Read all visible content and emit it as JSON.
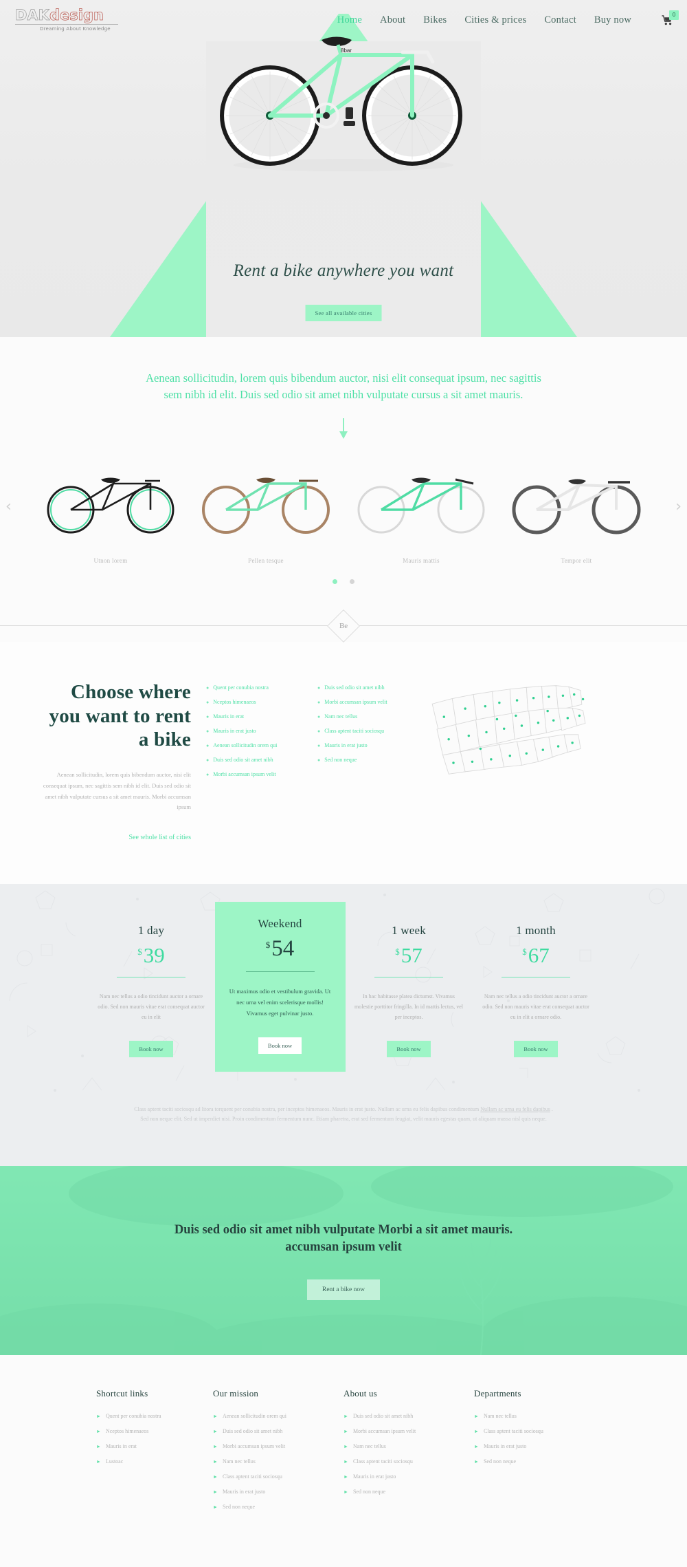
{
  "colors": {
    "mint": "#9df5c6",
    "mint_text": "#4ee0a6",
    "dark_teal": "#1f4a44",
    "grey_text": "#b3b3b3",
    "hero_bg": "#eaeaea",
    "pricing_bg": "#eceef0"
  },
  "header": {
    "logo_main_1": "DAK",
    "logo_main_2": "design",
    "logo_tagline": "Dreaming About Knowledge",
    "nav": [
      {
        "label": "Home",
        "active": true
      },
      {
        "label": "About",
        "active": false
      },
      {
        "label": "Bikes",
        "active": false
      },
      {
        "label": "Cities & prices",
        "active": false
      },
      {
        "label": "Contact",
        "active": false
      },
      {
        "label": "Buy now",
        "active": false
      }
    ],
    "cart_icon": "shopping-cart-icon",
    "cart_count": "0"
  },
  "hero": {
    "title": "Rent a bike anywhere you want",
    "button": "See all available cities"
  },
  "intro": {
    "lead": "Aenean sollicitudin, lorem quis bibendum auctor, nisi elit consequat ipsum, nec sagittis sem nibh id elit. Duis sed odio sit amet nibh vulputate cursus a sit amet mauris.",
    "arrow_icon": "arrow-down-icon"
  },
  "carousel": {
    "prev_icon": "chevron-left-icon",
    "next_icon": "chevron-right-icon",
    "items": [
      {
        "caption": "Utnon lorem"
      },
      {
        "caption": "Pellen tesque"
      },
      {
        "caption": "Mauris mattis"
      },
      {
        "caption": "Tempor elit"
      }
    ],
    "dots": [
      {
        "active": true
      },
      {
        "active": false
      }
    ]
  },
  "divider": {
    "label": "Be"
  },
  "cities": {
    "heading": "Choose where you want to rent a bike",
    "paragraph": "Aenean sollicitudin, lorem quis bibendum auctor, nisi elit consequat ipsum, nec sagittis sem nibh id elit. Duis sed odio sit amet nibh vulputate cursus a sit amet mauris. Morbi accumsan ipsum",
    "link": "See whole list of cities",
    "col1": [
      "Quent per conubia nostra",
      "Nceptos himenaeos",
      "Mauris in erat",
      "Mauris in erat justo",
      "Aenean sollicitudin orem qui",
      "Duis sed odio sit amet nibh",
      "Morbi accumsan ipsum velit"
    ],
    "col2": [
      "Duis sed odio sit amet nibh",
      "Morbi accumsan ipsum velit",
      "Nam nec tellus",
      "Class aptent taciti sociosqu",
      "Mauris in erat justo",
      "Sed non neque"
    ],
    "map_icon": "usa-map"
  },
  "pricing": {
    "plans": [
      {
        "title": "1 day",
        "currency": "$",
        "amount": "39",
        "desc": "Nam nec tellus a odio tincidunt auctor a ornare odio. Sed non mauris vitae erat consequat auctor eu in elit",
        "button": "Book now",
        "featured": false
      },
      {
        "title": "Weekend",
        "currency": "$",
        "amount": "54",
        "desc": "Ut maximus odio et vestibulum gravida. Ut nec urna vel enim scelerisque mollis! Vivamus eget pulvinar justo.",
        "button": "Book now",
        "featured": true
      },
      {
        "title": "1 week",
        "currency": "$",
        "amount": "57",
        "desc": "In hac habitasse platea dictumst. Vivamus molestie porttitor fringilla. In id mattis lectus, vel per inceptos.",
        "button": "Book now",
        "featured": false
      },
      {
        "title": "1 month",
        "currency": "$",
        "amount": "67",
        "desc": "Nam nec tellus a odio tincidunt auctor a ornare odio. Sed non mauris vitae erat consequat auctor eu in elit a ornare odio.",
        "button": "Book now",
        "featured": false
      }
    ],
    "note_a": "Class aptent taciti sociosqu ad litora torquent per conubia nostra, per inceptos himenaeos. Mauris in erat justo. Nullam ac urna eu felis dapibus condimentum ",
    "note_link": "Nullam ac urna eu felis dapibus",
    "note_b": " . Sed non neque elit. Sed ut imperdiet nisi. Proin condimentum fermentum nunc. Etiam pharetra, erat sed fermentum feugiat, velit mauris egestas quam, ut aliquam massa nisl quis neque."
  },
  "cta": {
    "title": "Duis sed odio sit amet nibh vulputate Morbi a sit amet mauris. accumsan ipsum velit",
    "button": "Rent a bike now"
  },
  "footer": {
    "columns": [
      {
        "heading": "Shortcut links",
        "items": [
          "Quent per conubia nostra",
          "Nceptos himenaeos",
          "Mauris in erat",
          "Lustoac"
        ]
      },
      {
        "heading": "Our mission",
        "items": [
          "Aenean sollicitudin orem qui",
          "Duis sed odio sit amet nibh",
          "Morbi accumsan ipsum velit",
          "Nam nec tellus",
          "Class aptent taciti sociosqu",
          "Mauris in erat justo",
          "Sed non neque"
        ]
      },
      {
        "heading": "About us",
        "items": [
          "Duis sed odio sit amet nibh",
          "Morbi accumsan ipsum velit",
          "Nam nec tellus",
          "Class aptent taciti sociosqu",
          "Mauris in erat justo",
          "Sed non neque"
        ]
      },
      {
        "heading": "Departments",
        "items": [
          "Nam nec tellus",
          "Class aptent taciti sociosqu",
          "Mauris in erat justo",
          "Sed non neque"
        ]
      }
    ]
  }
}
